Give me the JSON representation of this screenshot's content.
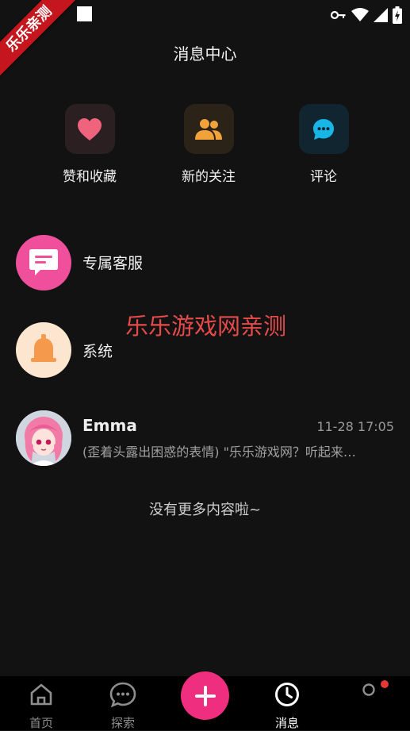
{
  "status_bar": {
    "ribbon_text": "乐乐亲测"
  },
  "header": {
    "title": "消息中心"
  },
  "quick_actions": [
    {
      "label": "赞和收藏",
      "icon": "heart-icon",
      "color": "#f0637c",
      "bg": "#2b1f22"
    },
    {
      "label": "新的关注",
      "icon": "users-icon",
      "color": "#f2a23a",
      "bg": "#2b2318"
    },
    {
      "label": "评论",
      "icon": "chat-bubble-icon",
      "color": "#18b6e6",
      "bg": "#102530"
    }
  ],
  "rows": [
    {
      "name": "专属客服",
      "icon": "message-square-icon",
      "color": "#f0509b"
    },
    {
      "name": "系统",
      "icon": "bell-icon",
      "color": "#f59a4d",
      "bg": "#fde6d0"
    }
  ],
  "watermark": "乐乐游戏网亲测",
  "conversation": {
    "name": "Emma",
    "time": "11-28 17:05",
    "preview": "(歪着头露出困惑的表情) \"乐乐游戏网？听起来…"
  },
  "footer_note": "没有更多内容啦~",
  "tabbar": {
    "home": "首页",
    "explore": "探索",
    "messages": "消息",
    "accent": "#ef2e7f",
    "badge": "#e53935"
  }
}
